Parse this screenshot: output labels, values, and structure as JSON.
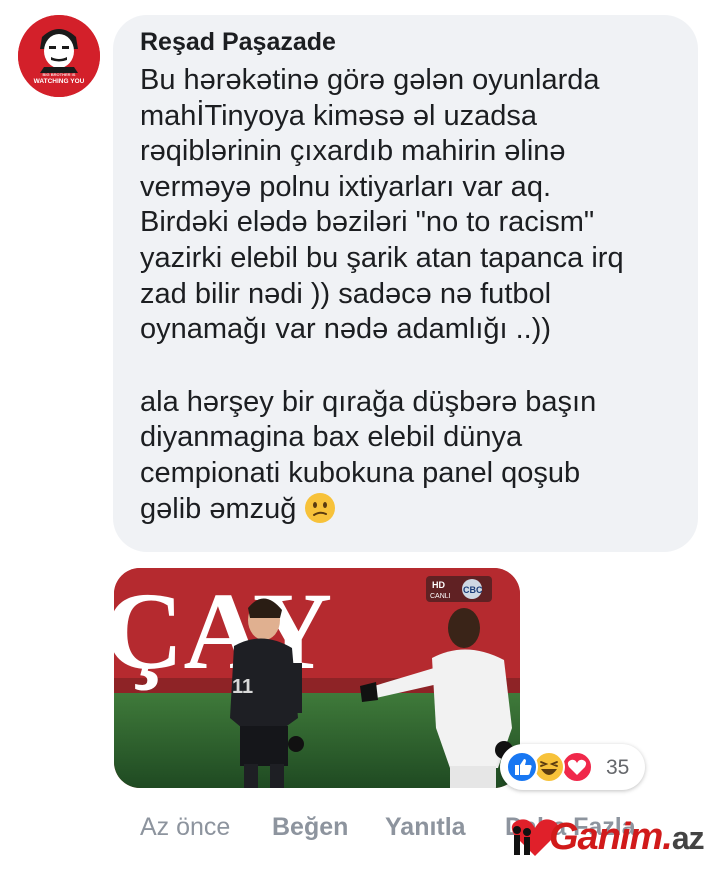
{
  "comment": {
    "avatar": {
      "icon": "watching-you-poster-icon",
      "caption_small": "BIG BROTHER IS",
      "caption": "WATCHING YOU"
    },
    "author": "Reşad Paşazade",
    "paragraph_1": "Bu hərəkətinə görə gələn oyunlarda\nmahİTinyoya kiməsə əl uzadsa\nrəqiblərinin çıxardıb mahirin əlinə\nverməyə polnu ixtiyarları var aq.\nBirdəki elədə bəziləri \"no to racism\"\nyazirki elebil bu şarik atan tapanca irq\nzad bilir nədi )) sadəcə nə futbol\noynamağı var nədə adamlığı ..))",
    "paragraph_2": "ala hərşey bir qırağa düşbərə başın\ndiyanmagina bax elebil dünya\ncempionati kubokuna panel qoşub\ngəlib əmzuğ",
    "emoji": "confused-face-icon"
  },
  "media": {
    "banner_text": "ÇAY",
    "broadcast_badge": "HD",
    "broadcast_live": "CANLI",
    "broadcast_channel": "CBC",
    "player_number": "11"
  },
  "reactions": {
    "icons": [
      "like-icon",
      "haha-icon",
      "love-icon"
    ],
    "count": "35"
  },
  "actions": {
    "time": "Az önce",
    "like": "Beğen",
    "reply": "Yanıtla",
    "more": "Daha Fazla"
  },
  "watermark": {
    "brand": "Ganim",
    "dot": ".",
    "tld": "az"
  }
}
